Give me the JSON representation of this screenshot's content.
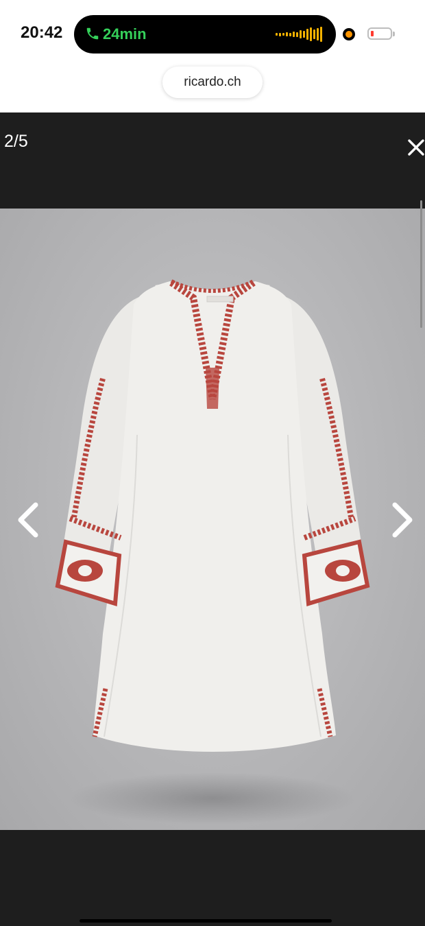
{
  "status_bar": {
    "time": "20:42",
    "call_duration": "24min",
    "url": "ricardo.ch"
  },
  "viewer": {
    "counter": "2/5",
    "close_icon": "close-icon",
    "prev_icon": "chevron-left-icon",
    "next_icon": "chevron-right-icon",
    "image_subject": "white tunic dress with red embroidery"
  },
  "colors": {
    "viewer_bg": "#1e1e1e",
    "photo_bg": "#b8b8ba",
    "embroidery": "#b8463e",
    "call_green": "#35d05a"
  }
}
